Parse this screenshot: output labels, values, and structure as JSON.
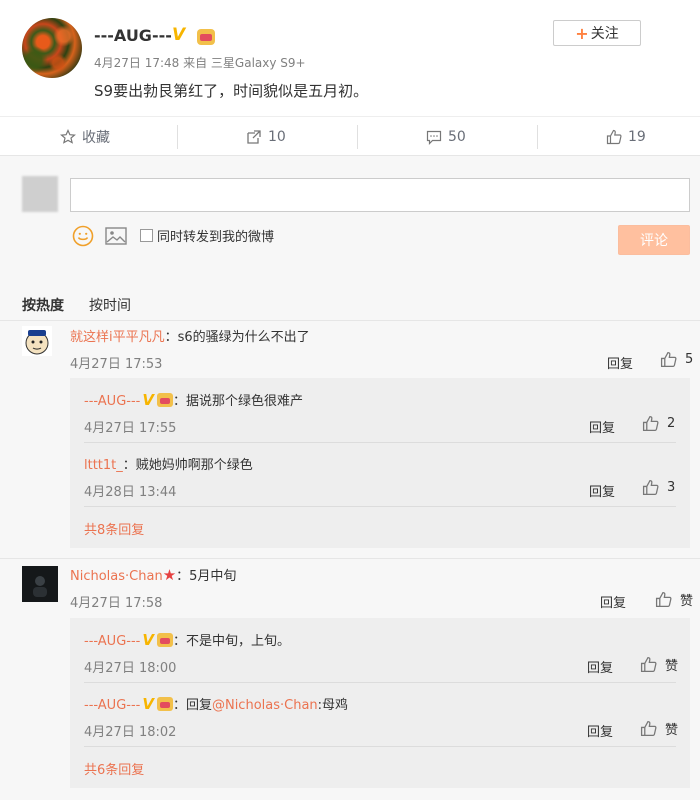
{
  "post": {
    "username": "---AUG---",
    "follow_label": "关注",
    "meta": "4月27日 17:48 来自 三星Galaxy S9+",
    "text": "S9要出勃艮第红了，时间貌似是五月初。"
  },
  "actions": {
    "favorite": "收藏",
    "repost": "10",
    "comments": "50",
    "likes": "19"
  },
  "composer": {
    "forward_label": "同时转发到我的微博",
    "submit_label": "评论"
  },
  "sort": {
    "hot": "按热度",
    "time": "按时间"
  },
  "comments": [
    {
      "name": "就这样i平平凡凡",
      "text": "：s6的骚绿为什么不出了",
      "time": "4月27日 17:53",
      "reply": "回复",
      "likes": "5",
      "subs": [
        {
          "name": "---AUG---",
          "text": "：据说那个绿色很难产",
          "time": "4月27日 17:55",
          "reply": "回复",
          "likes": "2"
        },
        {
          "name": "lttt1t_",
          "text": "：贼她妈帅啊那个绿色",
          "time": "4月28日 13:44",
          "reply": "回复",
          "likes": "3"
        }
      ],
      "more": "共8条回复"
    },
    {
      "name": "Nicholas·Chan",
      "text": "：5月中旬",
      "time": "4月27日 17:58",
      "reply": "回复",
      "likes": "赞",
      "subs": [
        {
          "name": "---AUG---",
          "text": "：不是中旬，上旬。",
          "time": "4月27日 18:00",
          "reply": "回复",
          "likes": "赞"
        },
        {
          "name": "---AUG---",
          "text_prefix": "：回复",
          "mention": "@Nicholas·Chan",
          "text_suffix": ":母鸡",
          "time": "4月27日 18:02",
          "reply": "回复",
          "likes": "赞"
        }
      ],
      "more": "共6条回复"
    }
  ],
  "colors": {
    "link": "#eb7350",
    "vip": "#f7b500",
    "submit_bg": "#ffc09f"
  }
}
